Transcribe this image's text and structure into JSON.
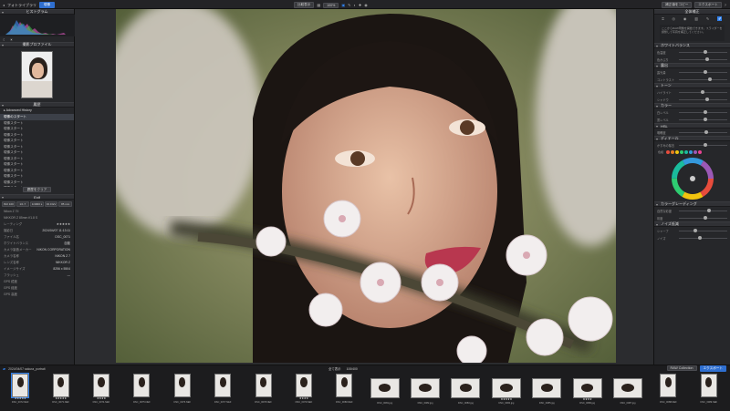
{
  "topbar": {
    "app_name": "フォトライブラリ",
    "mode_label": "現像",
    "center_btn": "比較表示",
    "zoom_label": "100%",
    "right_btn1": "補正値をコピー",
    "right_btn2": "エクスポート"
  },
  "left_panel": {
    "histogram_title": "ヒストグラム",
    "camera_title": "撮影プロファイル",
    "history_title": "履歴",
    "history_root": "Advanced History",
    "history_items": [
      "現像のスタート",
      "現像スタート",
      "現像スタート",
      "現像スタート",
      "現像スタート",
      "現像スタート",
      "現像スタート",
      "現像スタート",
      "現像スタート",
      "現像スタート",
      "現像スタート",
      "現像スタート",
      "現像スタート",
      "現像スタート",
      "現像スタート"
    ],
    "history_btn": "履歴をクリア",
    "info_title": "Exif",
    "exif_values": [
      "ISO 100",
      "1/1.7",
      "1/4000 s",
      "±0.0 EV",
      "85 mm"
    ],
    "lens": "NIKKOR Z 85mm f/1.8 S",
    "body": "Nikon Z 7II",
    "meta_rows": [
      {
        "k": "レーティング",
        "v": "★★★★★"
      },
      {
        "k": "撮影日",
        "v": "2024/04/07 11:13:11"
      },
      {
        "k": "ファイル名",
        "v": "DSC_0071"
      },
      {
        "k": "ホワイトバランス",
        "v": "自動"
      },
      {
        "k": "カメラ製造メーカー",
        "v": "NIKON CORPORATION"
      },
      {
        "k": "カメラ名称",
        "v": "NIKON Z 7"
      },
      {
        "k": "レンズ名称",
        "v": "NIKKOR Z"
      },
      {
        "k": "イメージサイズ",
        "v": "8256 x 5504"
      },
      {
        "k": "フラッシュ",
        "v": "—"
      },
      {
        "k": "GPS 緯度",
        "v": ""
      },
      {
        "k": "GPS 経度",
        "v": ""
      },
      {
        "k": "GPS 高度",
        "v": ""
      }
    ]
  },
  "right_panel": {
    "top_label": "全体補正",
    "note": "ここからRAW現像を開始できます。スライダーを調整して写真を補正してください。",
    "sections": [
      "ホワイトバランス",
      "露出",
      "トーン",
      "カラー",
      "HSL",
      "ディテール",
      "カラーグレーディング",
      "ノイズ低減"
    ],
    "slider_labels": [
      "色温度",
      "色かぶり",
      "露光量",
      "コントラスト",
      "ハイライト",
      "シャドウ",
      "白レベル",
      "黒レベル",
      "明瞭度",
      "かすみの除去",
      "自然な彩度",
      "彩度",
      "シャープ",
      "ノイズ",
      "レベル",
      "マスク"
    ],
    "hue_label": "色相",
    "swatches": [
      "#e74c3c",
      "#e67e22",
      "#f1c40f",
      "#2ecc71",
      "#1abc9c",
      "#3498db",
      "#9b59b6",
      "#e84393"
    ]
  },
  "filmstrip": {
    "path": "2024/04/07 sakura_portrait",
    "filter_label": "全て表示",
    "count": "100/400",
    "collection_btn": "RAW Collection",
    "export_btn": "エクスポート",
    "thumbs": [
      {
        "name": "DSC_0072.NEF",
        "stars": "★★★★★",
        "wide": false
      },
      {
        "name": "DSC_0073.NEF",
        "stars": "★★★★★",
        "wide": false
      },
      {
        "name": "DSC_0074.NEF",
        "stars": "★★★★",
        "wide": false
      },
      {
        "name": "DSC_0075.NEF",
        "stars": "",
        "wide": false
      },
      {
        "name": "DSC_0076.NEF",
        "stars": "",
        "wide": false
      },
      {
        "name": "DSC_0077.NEF",
        "stars": "",
        "wide": false
      },
      {
        "name": "DSC_0078.NEF",
        "stars": "",
        "wide": false
      },
      {
        "name": "DSC_0079.NEF",
        "stars": "★★★★",
        "wide": false
      },
      {
        "name": "DSC_0080.NEF",
        "stars": "",
        "wide": false
      },
      {
        "name": "DSC_0081.jpg",
        "stars": "",
        "wide": true
      },
      {
        "name": "DSC_0082.jpg",
        "stars": "",
        "wide": true
      },
      {
        "name": "DSC_0083.jpg",
        "stars": "",
        "wide": true
      },
      {
        "name": "DSC_0084.jpg",
        "stars": "★★★★★",
        "wide": true
      },
      {
        "name": "DSC_0085.jpg",
        "stars": "",
        "wide": true
      },
      {
        "name": "DSC_0086.jpg",
        "stars": "★★★★",
        "wide": true
      },
      {
        "name": "DSC_0087.jpg",
        "stars": "",
        "wide": true
      },
      {
        "name": "DSC_0088.NEF",
        "stars": "",
        "wide": false
      },
      {
        "name": "DSC_0089.NEF",
        "stars": "",
        "wide": false
      }
    ]
  }
}
